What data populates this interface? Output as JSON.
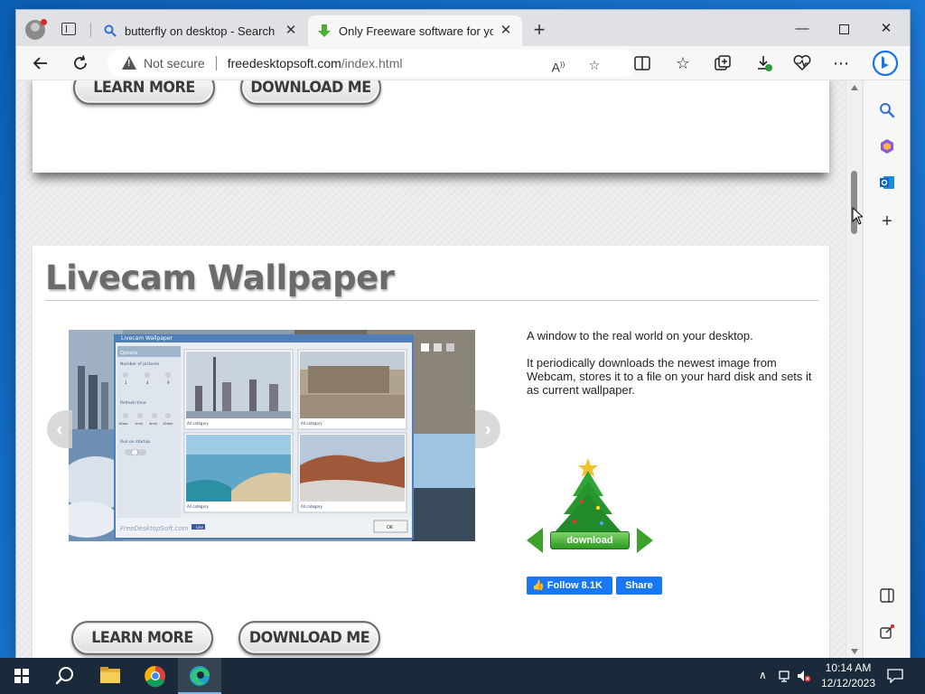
{
  "browser": {
    "tabs": [
      {
        "title": "butterfly on desktop - Search",
        "active": false
      },
      {
        "title": "Only Freeware software for your",
        "active": true
      }
    ],
    "address": {
      "security_label": "Not secure",
      "host": "freedesktopsoft.com",
      "path": "/index.html"
    },
    "window_controls": {
      "minimize": "—",
      "maximize": "",
      "close": "✕"
    }
  },
  "page": {
    "top_card": {
      "learn_more": "LEARN MORE",
      "download_me": "DOWNLOAD ME"
    },
    "main_card": {
      "title": "Livecam Wallpaper",
      "description": [
        "A window to the real world on your desktop.",
        "It periodically downloads the newest image from Webcam, stores it to a file on your hard disk and sets it as current wallpaper."
      ],
      "download_label": "download",
      "fb_follow": "Follow 8.1K",
      "fb_share": "Share",
      "learn_more": "LEARN MORE",
      "download_me": "DOWNLOAD ME",
      "screenshot": {
        "window_title": "Livecam Wallpaper",
        "options_label": "Options",
        "number_of_pictures": "Number of pictures",
        "pictures_values": [
          "1",
          "4",
          "9"
        ],
        "refresh_time": "Refresh time",
        "refresh_values": [
          "10sec",
          "1min",
          "3min",
          "10min"
        ],
        "run_on_startup": "Run on startup",
        "category_label": "All category",
        "watermark": "FreeDesktopSoft.com",
        "like_label": "Like",
        "ok_label": "OK"
      }
    }
  },
  "taskbar": {
    "time": "10:14 AM",
    "date": "12/12/2023"
  },
  "colors": {
    "facebook": "#1877f2",
    "download_green": "#3ca22c",
    "edge_accent": "#1a73e8"
  }
}
